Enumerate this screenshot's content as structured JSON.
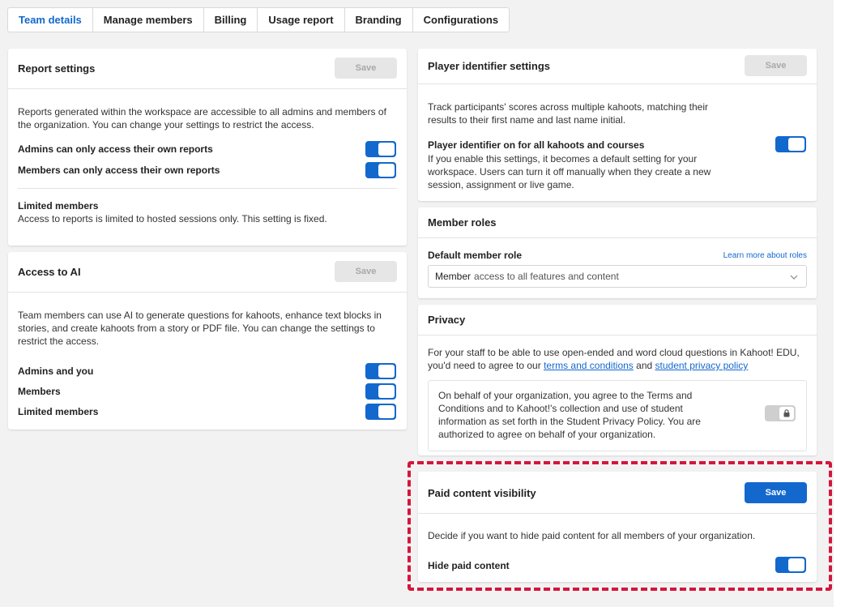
{
  "tabs": [
    {
      "label": "Team details",
      "active": true
    },
    {
      "label": "Manage members"
    },
    {
      "label": "Billing"
    },
    {
      "label": "Usage report"
    },
    {
      "label": "Branding"
    },
    {
      "label": "Configurations"
    }
  ],
  "report": {
    "title": "Report settings",
    "save": "Save",
    "desc": "Reports generated within the workspace are accessible to all admins and members of the organization. You can change your settings to restrict the access.",
    "admins_label": "Admins can only access their own reports",
    "members_label": "Members can only access their own reports",
    "limited_title": "Limited members",
    "limited_desc": "Access to reports is limited to hosted sessions only. This setting is fixed."
  },
  "ai": {
    "title": "Access to AI",
    "save": "Save",
    "desc": "Team members can use AI to generate questions for kahoots, enhance text blocks in stories, and create kahoots from a story or PDF file. You can change the settings to restrict the access.",
    "admins_label": "Admins and you",
    "members_label": "Members",
    "limited_label": "Limited members"
  },
  "player": {
    "title": "Player identifier settings",
    "save": "Save",
    "desc": "Track participants' scores across multiple kahoots, matching their results to their first name and last name initial.",
    "option_label": "Player identifier on for all kahoots and courses",
    "option_desc": "If you enable this settings, it becomes a default setting for your workspace. Users can turn it off manually when they create a new session, assignment or live game."
  },
  "roles": {
    "title": "Member roles",
    "default_label": "Default member role",
    "learn_more": "Learn more about roles",
    "select_strong": "Member",
    "select_rest": "access to all features and content"
  },
  "privacy": {
    "title": "Privacy",
    "desc_part1": "For your staff to be able to use open-ended and word cloud questions in Kahoot! EDU, you'd need to agree to our",
    "terms_link": "terms and conditions",
    "and": "and",
    "privacy_link": "student privacy policy",
    "agreement": "On behalf of your organization, you agree to the Terms and Conditions and to Kahoot!'s collection and use of student information as set forth in the Student Privacy Policy. You are authorized to agree on behalf of your organization."
  },
  "paid": {
    "title": "Paid content visibility",
    "save": "Save",
    "desc": "Decide if you want to hide paid content for all members of your organization.",
    "hide_label": "Hide paid content"
  },
  "colors": {
    "accent": "#1368ce",
    "highlight": "#d4163c",
    "background": "#f2f2f2"
  }
}
